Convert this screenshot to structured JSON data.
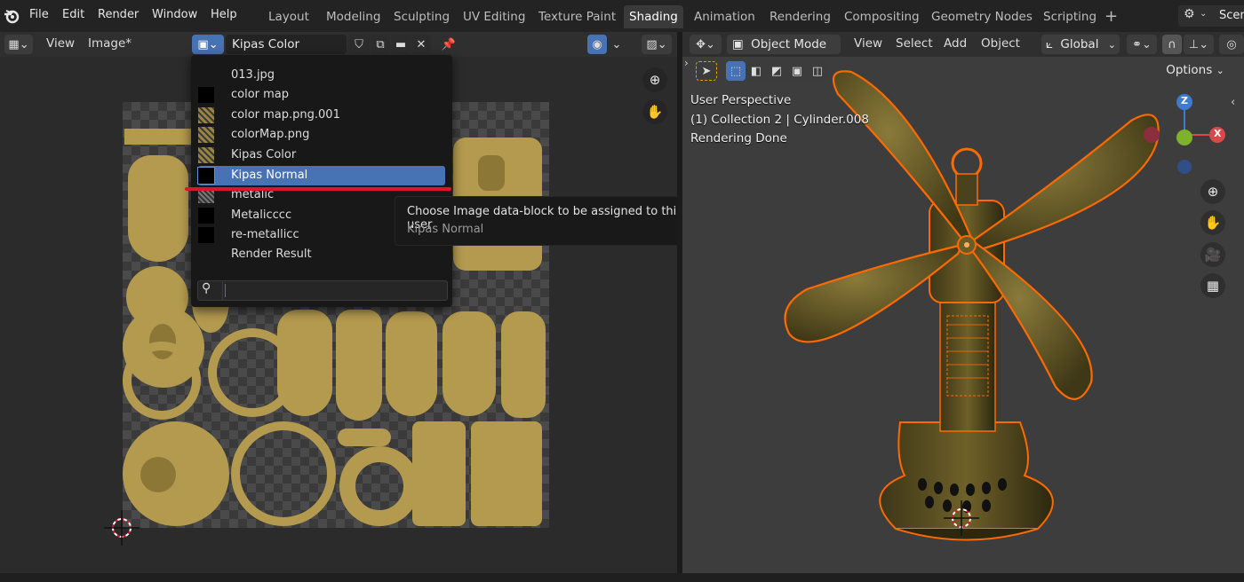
{
  "topbar": {
    "menus": [
      "File",
      "Edit",
      "Render",
      "Window",
      "Help"
    ],
    "workspace_tabs": [
      "Layout",
      "Modeling",
      "Sculpting",
      "UV Editing",
      "Texture Paint",
      "Shading",
      "Animation",
      "Rendering",
      "Compositing",
      "Geometry Nodes",
      "Scripting"
    ],
    "active_tab": "Shading",
    "add_tab_icon": "plus-icon",
    "scene_label": "Scen"
  },
  "image_editor": {
    "view_label": "View",
    "image_menu_label": "Image*",
    "image_name": "Kipas Color",
    "popup": {
      "items": [
        {
          "label": "013.jpg",
          "thumb": "none"
        },
        {
          "label": "color map",
          "thumb": "black"
        },
        {
          "label": "color map.png.001",
          "thumb": "texture"
        },
        {
          "label": "colorMap.png",
          "thumb": "texture"
        },
        {
          "label": "Kipas Color",
          "thumb": "texture"
        },
        {
          "label": "Kipas Normal",
          "thumb": "black"
        },
        {
          "label": "metalic",
          "thumb": "gray"
        },
        {
          "label": "Metalicccc",
          "thumb": "black"
        },
        {
          "label": "re-metallicc",
          "thumb": "black"
        },
        {
          "label": "Render Result",
          "thumb": "none"
        }
      ],
      "selected": "Kipas Normal",
      "search_value": ""
    },
    "tooltip": {
      "title": "Choose Image data-block to be assigned to this user",
      "value": "Kipas Normal"
    }
  },
  "viewport": {
    "mode": "Object Mode",
    "menus": [
      "View",
      "Select",
      "Add",
      "Object"
    ],
    "transform_orientation": "Global",
    "options_label": "Options",
    "overlay_lines": [
      "User Perspective",
      "(1) Collection 2 | Cylinder.008",
      "Rendering Done"
    ],
    "gizmo_axes": {
      "z": "Z",
      "x": "X"
    }
  },
  "colors": {
    "accent_blue": "#4772b3",
    "selection_orange": "#ff6a00",
    "annotation_red": "#d8172a",
    "texture_gold": "#b39a4e"
  }
}
